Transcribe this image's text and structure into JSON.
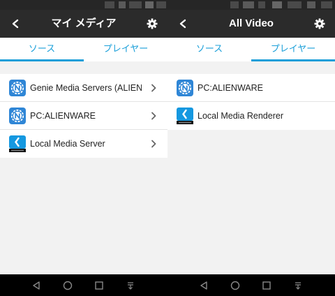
{
  "left": {
    "title": "マイ メディア",
    "tabs": [
      {
        "label": "ソース",
        "active": true
      },
      {
        "label": "プレイヤー",
        "active": false
      }
    ],
    "items": [
      {
        "label": "Genie Media Servers (ALIENW...",
        "icon": "netgear-genie-icon"
      },
      {
        "label": "PC:ALIENWARE",
        "icon": "netgear-genie-icon"
      },
      {
        "label": "Local Media Server",
        "icon": "netgear-local-icon"
      }
    ]
  },
  "right": {
    "title": "All Video",
    "tabs": [
      {
        "label": "ソース",
        "active": false
      },
      {
        "label": "プレイヤー",
        "active": true
      }
    ],
    "items": [
      {
        "label": "PC:ALIENWARE",
        "icon": "netgear-genie-icon"
      },
      {
        "label": "Local Media Renderer",
        "icon": "netgear-local-icon"
      }
    ]
  },
  "colors": {
    "accent": "#1a9fd9",
    "titlebar": "#2b2b2b",
    "background": "#f2f2f2",
    "navbar": "#000000"
  }
}
